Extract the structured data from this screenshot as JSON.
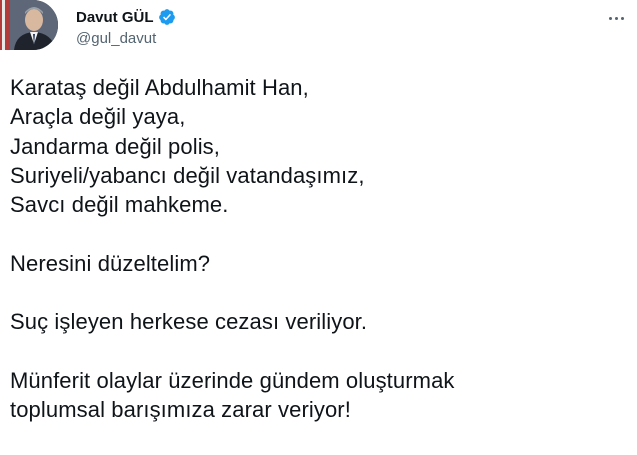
{
  "user": {
    "display_name": "Davut GÜL",
    "handle": "@gul_davut",
    "verified": true
  },
  "icons": {
    "verified": "verified-badge-icon",
    "more": "more-horizontal-icon"
  },
  "colors": {
    "verified_blue": "#1d9bf0",
    "text": "#0f1419",
    "secondary": "#536471"
  },
  "tweet": {
    "paragraphs": [
      {
        "lines": [
          "Karataş değil Abdulhamit Han,",
          "Araçla değil yaya,",
          "Jandarma değil polis,",
          "Suriyeli/yabancı değil vatandaşımız,",
          "Savcı değil mahkeme."
        ]
      },
      {
        "lines": [
          "Neresini düzeltelim?"
        ]
      },
      {
        "lines": [
          "Suç işleyen herkese cezası veriliyor."
        ]
      },
      {
        "lines": [
          "Münferit olaylar üzerinde gündem oluşturmak",
          "toplumsal barışımıza zarar veriyor!"
        ]
      }
    ]
  }
}
